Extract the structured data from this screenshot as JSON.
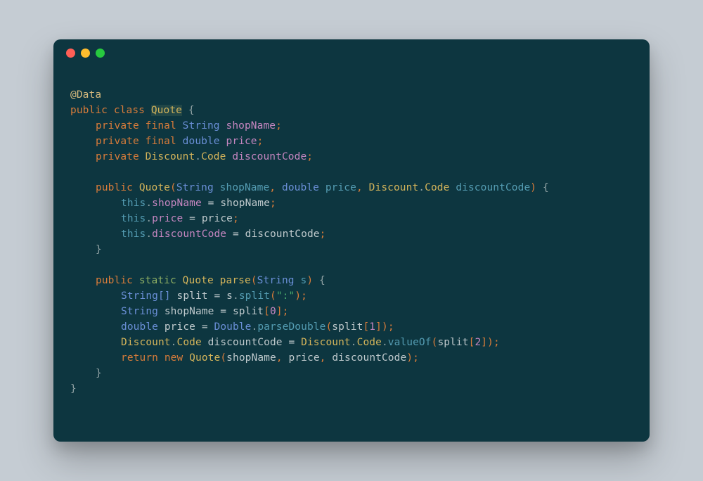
{
  "code_tokens": {
    "annotation": "@Data",
    "kw_public": "public",
    "kw_class": "class",
    "kw_private": "private",
    "kw_final": "final",
    "kw_static": "static",
    "kw_return": "return",
    "kw_new": "new",
    "kw_this": "this",
    "type_String": "String",
    "type_double": "double",
    "type_StringArr": "String[]",
    "type_Double": "Double",
    "class_Quote": "Quote",
    "class_Discount": "Discount",
    "class_Code": "Code",
    "field_shopName": "shopName",
    "field_price": "price",
    "field_discountCode": "discountCode",
    "var_split": "split",
    "var_s": "s",
    "method_parse": "parse",
    "method_split": "split",
    "method_parseDouble": "parseDouble",
    "method_valueOf": "valueOf",
    "str_colon": "\":\"",
    "num_0": "0",
    "num_1": "1",
    "num_2": "2",
    "brace_open": "{",
    "brace_close": "}",
    "paren_open": "(",
    "paren_close": ")",
    "bracket_open": "[",
    "bracket_close": "]",
    "semi": ";",
    "comma": ",",
    "dot": ".",
    "eq": " = ",
    "sp": " "
  },
  "colors": {
    "background_page": "#c5ccd3",
    "background_window": "#0d3640",
    "dot_red": "#ff5f56",
    "dot_yellow": "#ffbd2e",
    "dot_green": "#27c93f"
  }
}
